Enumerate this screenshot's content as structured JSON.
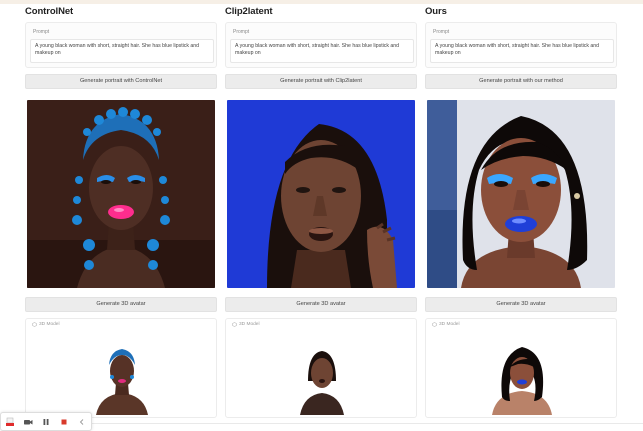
{
  "columns": [
    {
      "title": "ControlNet",
      "prompt_label": "Prompt",
      "prompt_text": "A young black woman with short, straight hair. She has blue lipstick and makeup on",
      "generate_button": "Generate portrait with ControlNet",
      "avatar_button": "Generate 3D avatar",
      "model_label": "3D Model"
    },
    {
      "title": "Clip2latent",
      "prompt_label": "Prompt",
      "prompt_text": "A young black woman with short, straight hair. She has blue lipstick and makeup on",
      "generate_button": "Generate portrait with Clip2latent",
      "avatar_button": "Generate 3D avatar",
      "model_label": "3D Model"
    },
    {
      "title": "Ours",
      "prompt_label": "Prompt",
      "prompt_text": "A young black woman with short, straight hair. She has blue lipstick and makeup on",
      "generate_button": "Generate portrait with our method",
      "avatar_button": "Generate 3D avatar",
      "model_label": "3D Model"
    }
  ],
  "recorder_controls": {
    "icons": [
      "recorder-app-icon",
      "camera-icon",
      "pause-icon",
      "stop-icon",
      "collapse-chevron-icon"
    ]
  },
  "colors": {
    "button_bg": "#ececec",
    "border": "#ececec",
    "lipstick_controlnet": "#ff2d8e",
    "lipstick_ours": "#1f3fd8",
    "bg_clip2latent": "#1f3ad6",
    "stop_red": "#d83a2b"
  }
}
